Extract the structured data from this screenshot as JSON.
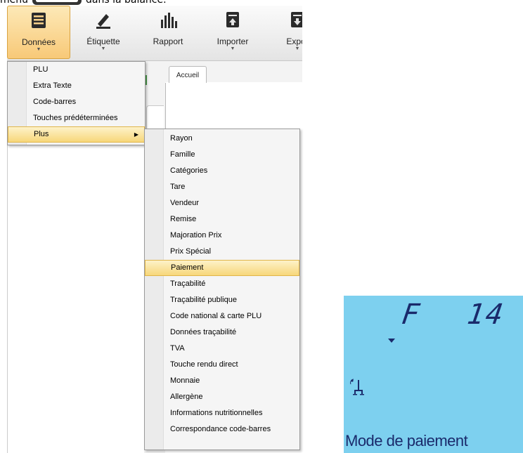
{
  "caption": {
    "prefix": "menu",
    "suffix": "dans la balance."
  },
  "ribbon": {
    "buttons": [
      {
        "label": "Données",
        "icon": "database-icon",
        "has_dropdown": true,
        "active": true
      },
      {
        "label": "Étiquette",
        "icon": "pen-icon",
        "has_dropdown": true,
        "active": false
      },
      {
        "label": "Rapport",
        "icon": "bar-chart-icon",
        "has_dropdown": false,
        "active": false
      },
      {
        "label": "Importer",
        "icon": "import-icon",
        "has_dropdown": true,
        "active": false
      },
      {
        "label": "Expor",
        "icon": "export-icon",
        "has_dropdown": true,
        "active": false
      }
    ]
  },
  "tab": {
    "label": "Accueil"
  },
  "menu_donnees": {
    "items": [
      {
        "label": "PLU"
      },
      {
        "label": "Extra Texte"
      },
      {
        "label": "Code-barres"
      },
      {
        "label": "Touches prédéterminées"
      },
      {
        "label": "Plus",
        "submenu": true,
        "highlighted": true
      }
    ]
  },
  "menu_plus": {
    "items": [
      {
        "label": "Rayon"
      },
      {
        "label": "Famille"
      },
      {
        "label": "Catégories"
      },
      {
        "label": "Tare"
      },
      {
        "label": "Vendeur"
      },
      {
        "label": "Remise"
      },
      {
        "label": "Majoration Prix"
      },
      {
        "label": "Prix Spécial"
      },
      {
        "label": "Paiement",
        "highlighted": true
      },
      {
        "label": "Traçabilité"
      },
      {
        "label": "Traçabilité publique"
      },
      {
        "label": "Code national & carte PLU"
      },
      {
        "label": "Données traçabilité"
      },
      {
        "label": "TVA"
      },
      {
        "label": "Touche rendu direct"
      },
      {
        "label": "Monnaie"
      },
      {
        "label": "Allergène"
      },
      {
        "label": "Informations nutritionnelles"
      },
      {
        "label": "Correspondance code-barres"
      }
    ]
  },
  "lcd": {
    "function_char": "F",
    "code_digits": "14",
    "mode_text": "Mode de paiement",
    "background": "#7dd0ef",
    "segment_color": "#1a2a6b"
  },
  "colors": {
    "highlight_top": "#fdf2c9",
    "highlight_bottom": "#f7d77a",
    "active_ribbon": "#f8c978"
  }
}
